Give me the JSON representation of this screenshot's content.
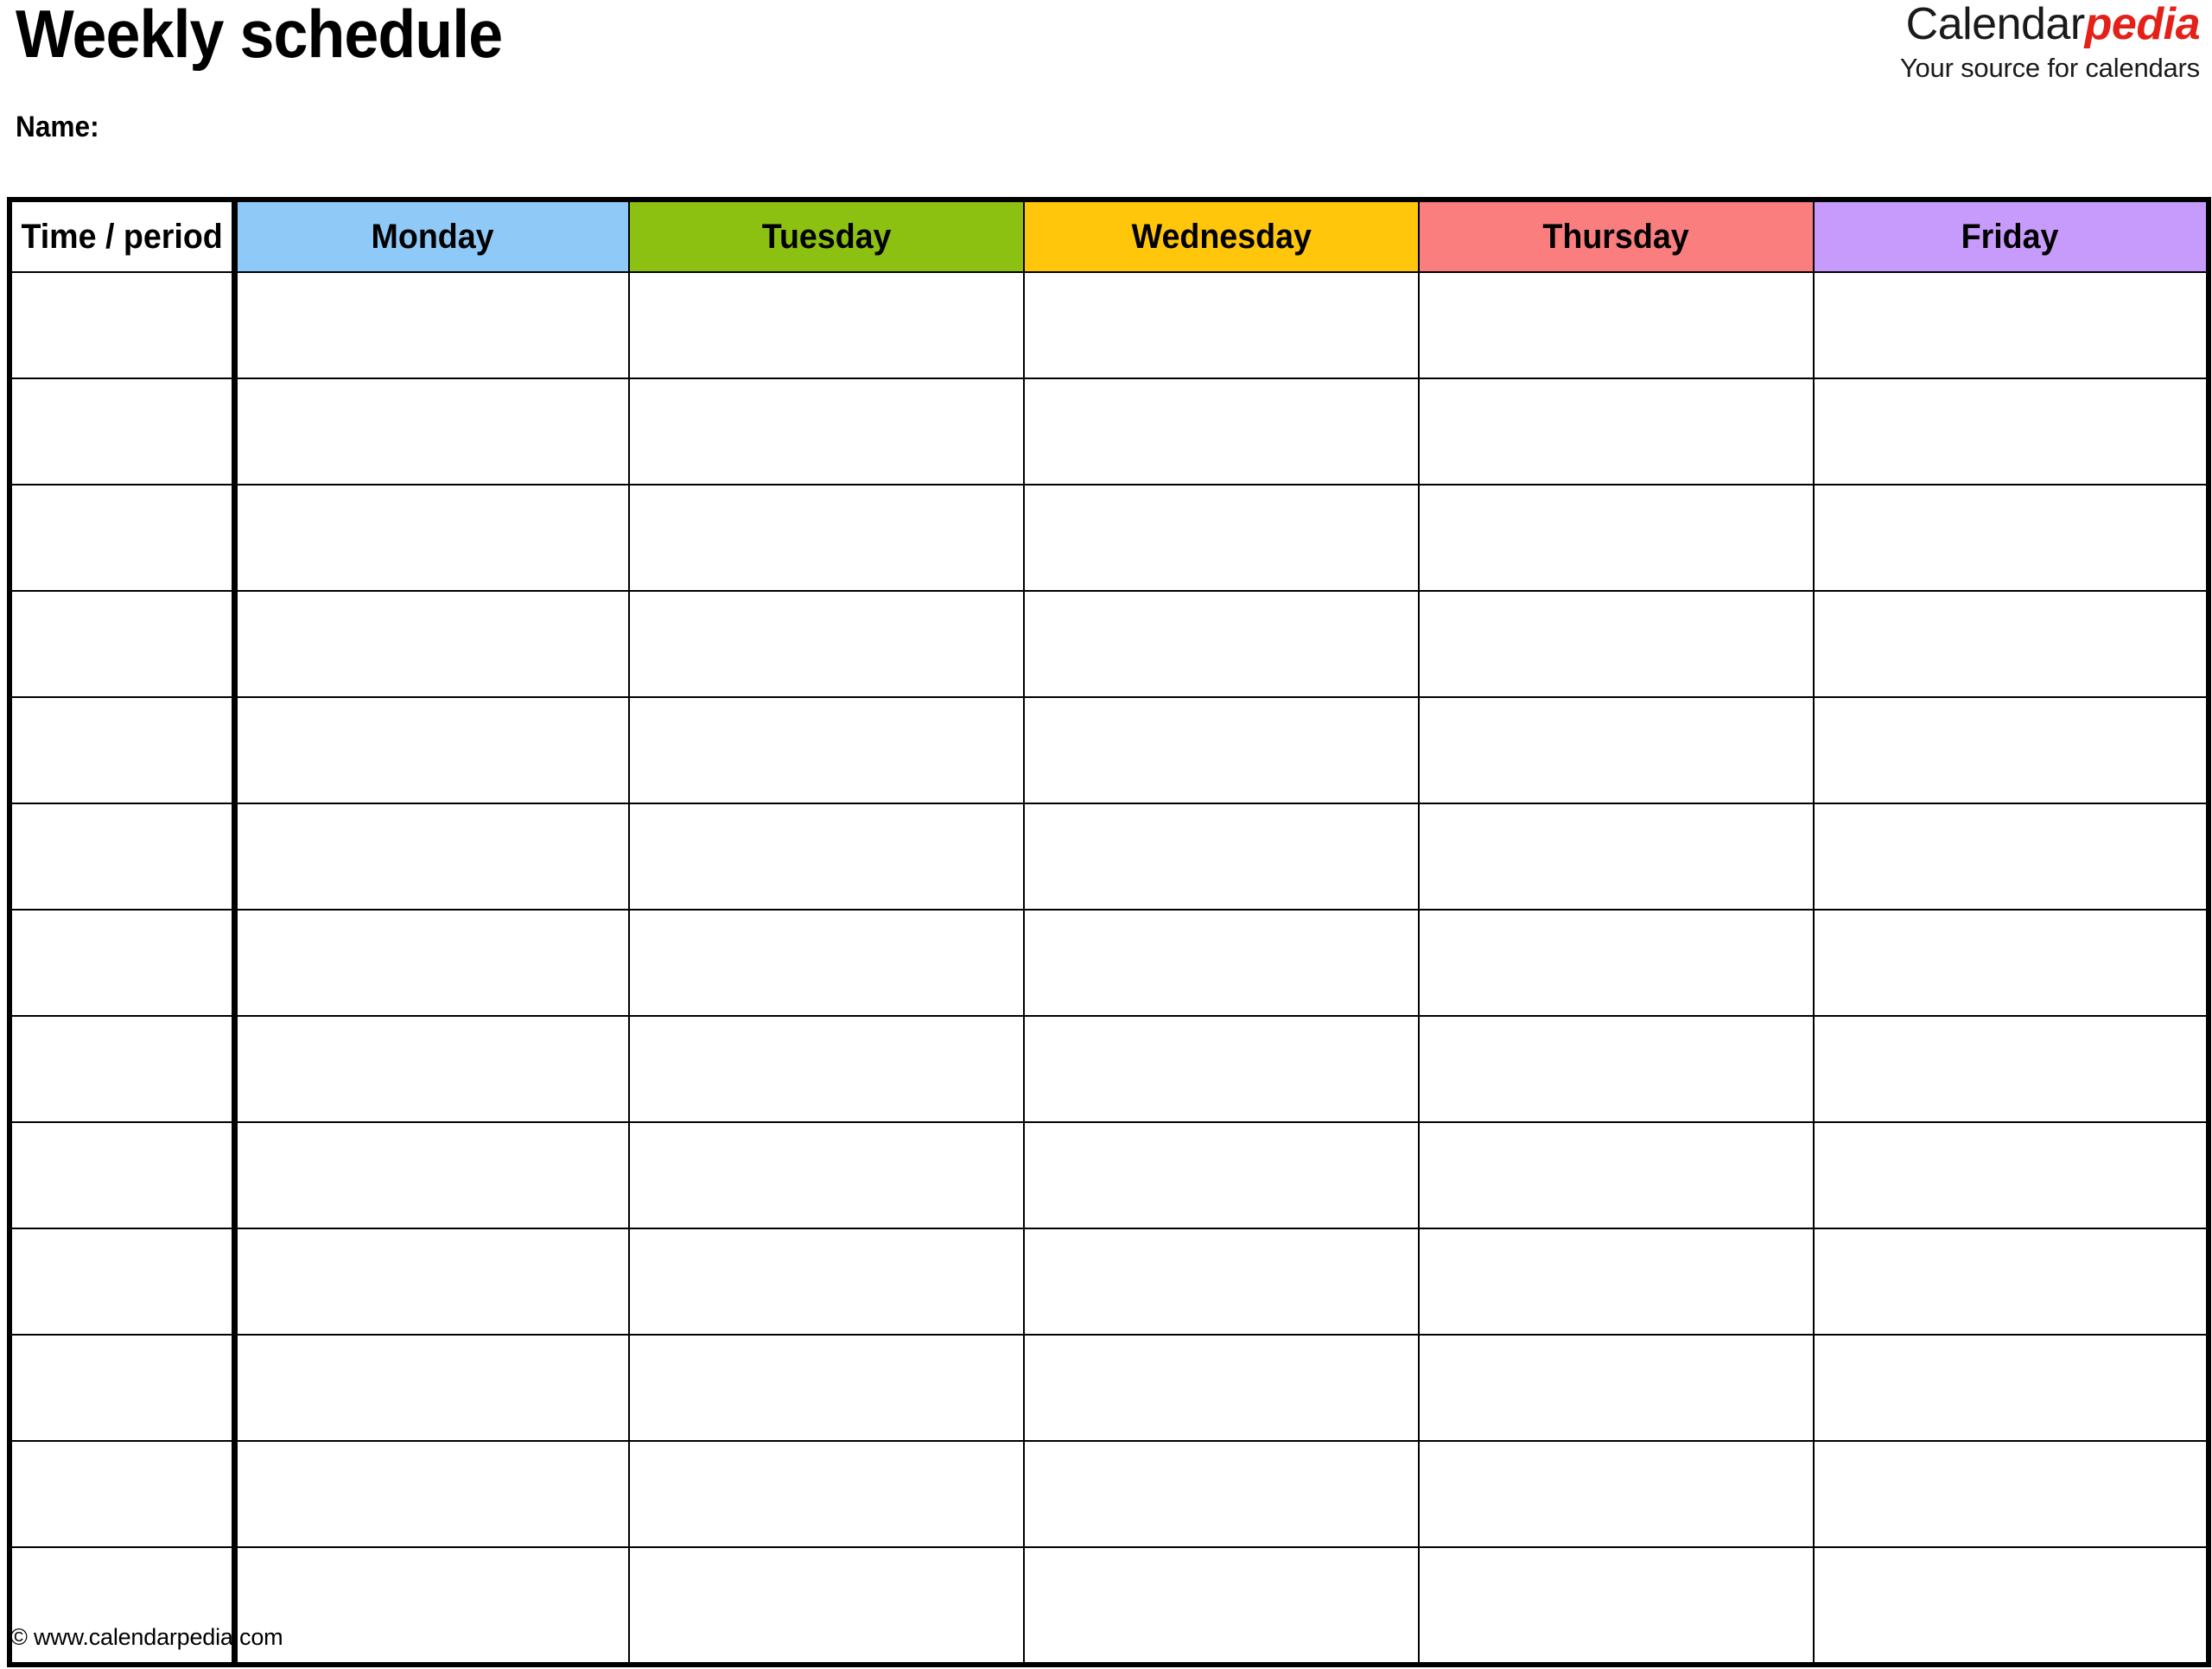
{
  "document": {
    "title": "Weekly schedule",
    "name_label": "Name:"
  },
  "brand": {
    "name_part1": "Calendar",
    "name_part2": "pedia",
    "tagline": "Your source for calendars",
    "accent_color": "#e32119",
    "text_color": "#1a1a1a"
  },
  "table": {
    "columns": [
      {
        "label": "Time / period",
        "bg": "#ffffff"
      },
      {
        "label": "Monday",
        "bg": "#8fc9f8"
      },
      {
        "label": "Tuesday",
        "bg": "#8cc111"
      },
      {
        "label": "Wednesday",
        "bg": "#ffc60b"
      },
      {
        "label": "Thursday",
        "bg": "#fa7e7e"
      },
      {
        "label": "Friday",
        "bg": "#c79bfb"
      }
    ],
    "row_count": 13,
    "cells": [
      [
        "",
        "",
        "",
        "",
        "",
        ""
      ],
      [
        "",
        "",
        "",
        "",
        "",
        ""
      ],
      [
        "",
        "",
        "",
        "",
        "",
        ""
      ],
      [
        "",
        "",
        "",
        "",
        "",
        ""
      ],
      [
        "",
        "",
        "",
        "",
        "",
        ""
      ],
      [
        "",
        "",
        "",
        "",
        "",
        ""
      ],
      [
        "",
        "",
        "",
        "",
        "",
        ""
      ],
      [
        "",
        "",
        "",
        "",
        "",
        ""
      ],
      [
        "",
        "",
        "",
        "",
        "",
        ""
      ],
      [
        "",
        "",
        "",
        "",
        "",
        ""
      ],
      [
        "",
        "",
        "",
        "",
        "",
        ""
      ],
      [
        "",
        "",
        "",
        "",
        "",
        ""
      ],
      [
        "",
        "",
        "",
        "",
        "",
        ""
      ]
    ],
    "border_color": "#000000"
  },
  "footer": {
    "copyright": "© www.calendarpedia.com"
  }
}
